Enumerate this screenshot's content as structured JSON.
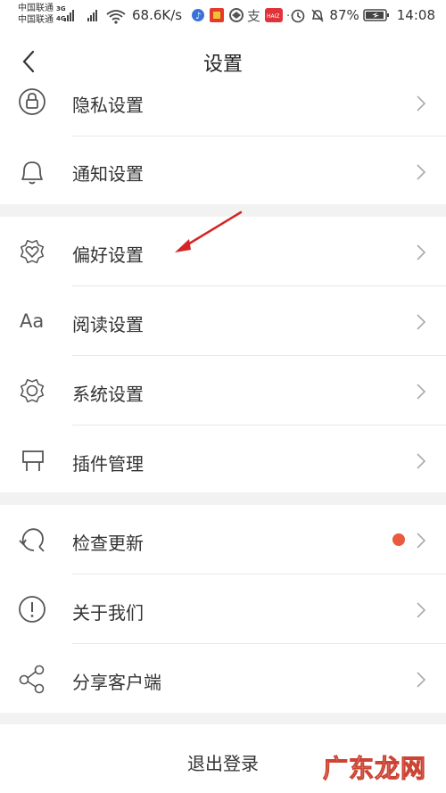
{
  "status_bar": {
    "carrier_1": "中国联通",
    "carrier_2": "中国联通",
    "network_1": "3G",
    "network_2": "4G",
    "speed": "68.6K/s",
    "battery": "87%",
    "time": "14:08"
  },
  "header": {
    "title": "设置",
    "back_icon": "chevron-left-icon"
  },
  "settings": {
    "items": [
      {
        "label": "隐私设置",
        "icon": "lock-icon"
      },
      {
        "label": "通知设置",
        "icon": "bell-icon"
      },
      {
        "label": "偏好设置",
        "icon": "heart-badge-icon"
      },
      {
        "label": "阅读设置",
        "icon": "font-aa-icon",
        "icon_text": "Aa"
      },
      {
        "label": "系统设置",
        "icon": "gear-icon"
      },
      {
        "label": "插件管理",
        "icon": "plugin-icon"
      },
      {
        "label": "检查更新",
        "icon": "refresh-icon",
        "badge": "update-dot"
      },
      {
        "label": "关于我们",
        "icon": "info-icon"
      },
      {
        "label": "分享客户端",
        "icon": "share-icon"
      }
    ]
  },
  "logout": {
    "label": "退出登录"
  },
  "watermark": "广东龙网",
  "colors": {
    "badge": "#ea5a3d",
    "annotation_arrow": "#d42424",
    "divider": "#e8e8e8",
    "section_gap": "#f2f2f2"
  }
}
